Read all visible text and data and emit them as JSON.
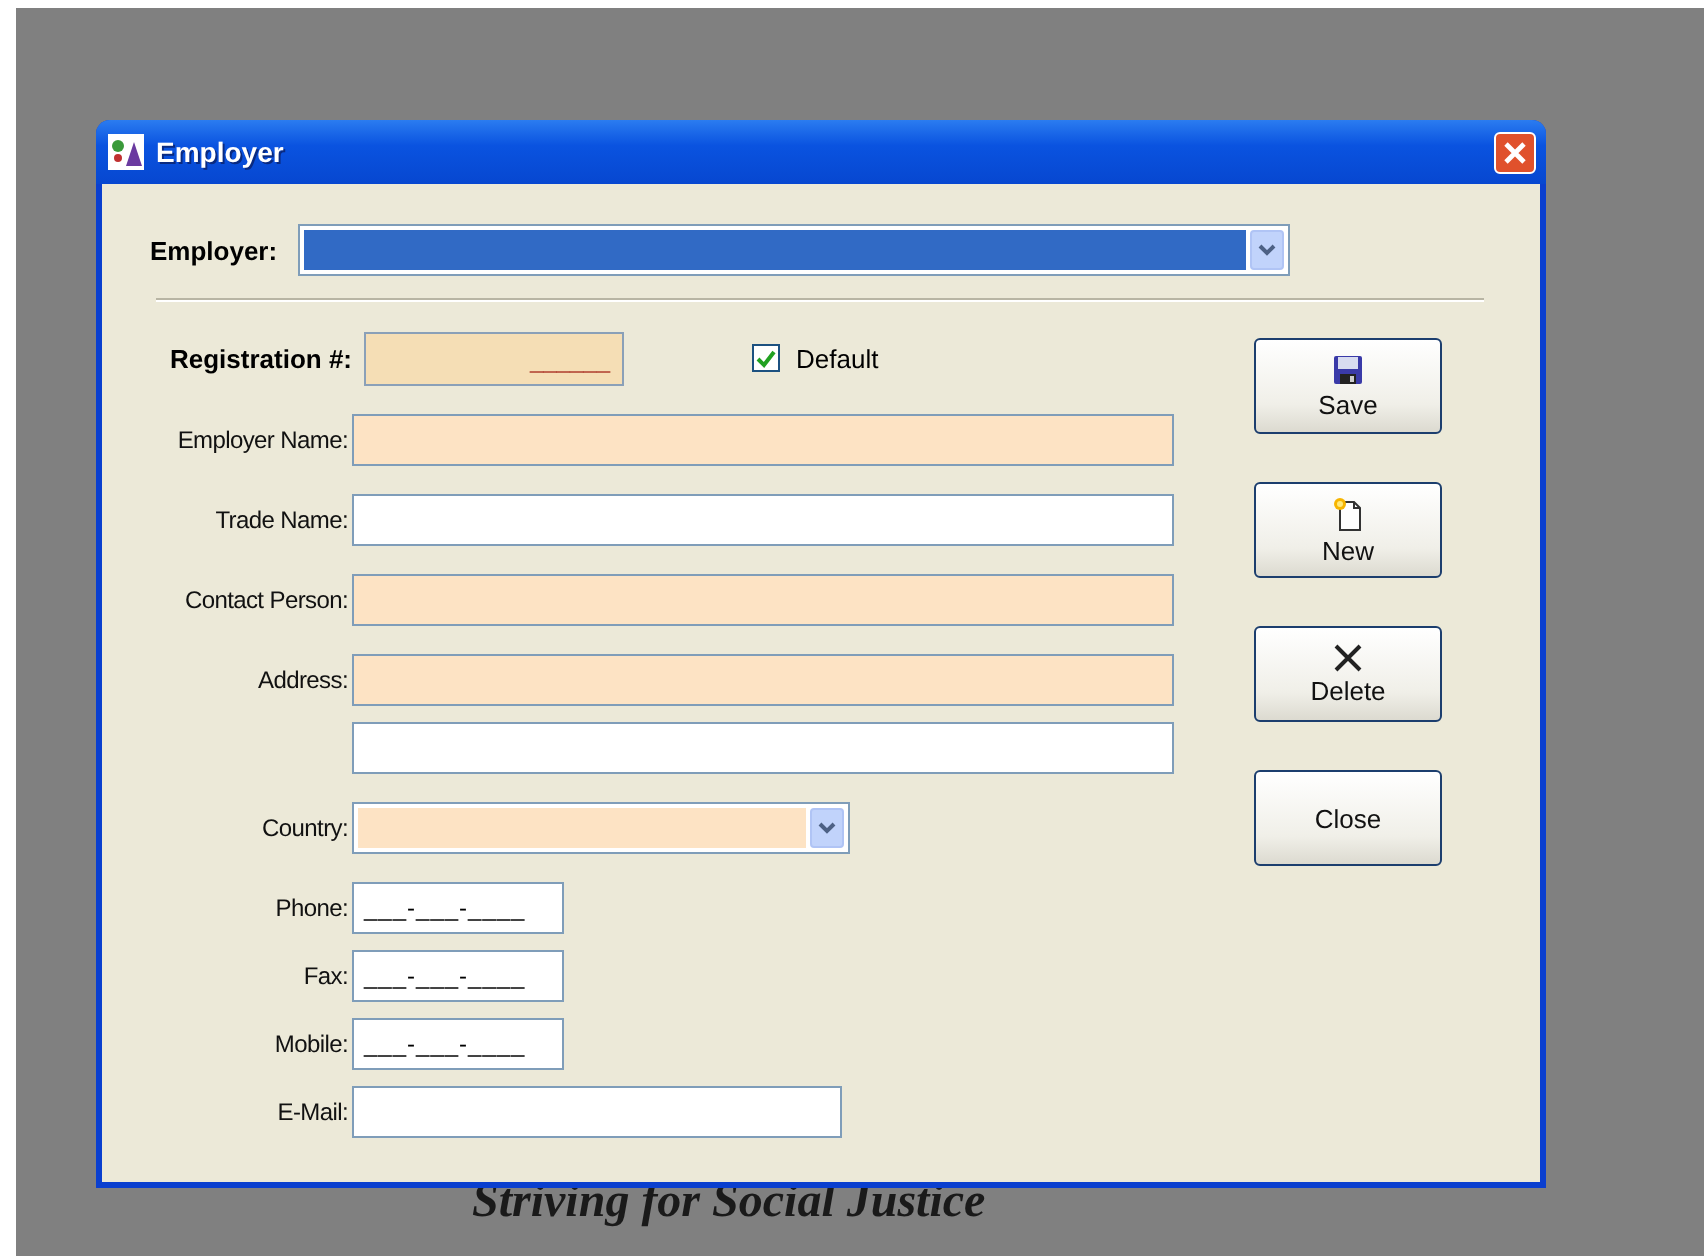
{
  "window": {
    "title": "Employer"
  },
  "employer_selector": {
    "label": "Employer:",
    "highlighted": true
  },
  "registration": {
    "label": "Registration #:",
    "value": "______",
    "required": true
  },
  "default_checkbox": {
    "label": "Default",
    "checked": true
  },
  "fields": [
    {
      "label": "Employer Name:",
      "kind": "text",
      "required": true
    },
    {
      "label": "Trade Name:",
      "kind": "text",
      "required": false
    },
    {
      "label": "Contact Person:",
      "kind": "text",
      "required": true
    },
    {
      "label": "Address:",
      "kind": "text",
      "required": true
    },
    {
      "kind": "text",
      "required": false
    },
    {
      "label": "Country:",
      "kind": "combo",
      "required": true
    },
    {
      "label": "Phone:",
      "kind": "masked",
      "required": false,
      "value": "___-___-____"
    },
    {
      "label": "Fax:",
      "kind": "masked",
      "required": false,
      "value": "___-___-____"
    },
    {
      "label": "Mobile:",
      "kind": "masked",
      "required": false,
      "value": "___-___-____"
    },
    {
      "label": "E-Mail:",
      "kind": "email",
      "required": false
    }
  ],
  "buttons": [
    {
      "label": "Save"
    },
    {
      "label": "New"
    },
    {
      "label": "Delete"
    },
    {
      "label": "Close"
    }
  ],
  "background_text": "Striving for Social Justice"
}
